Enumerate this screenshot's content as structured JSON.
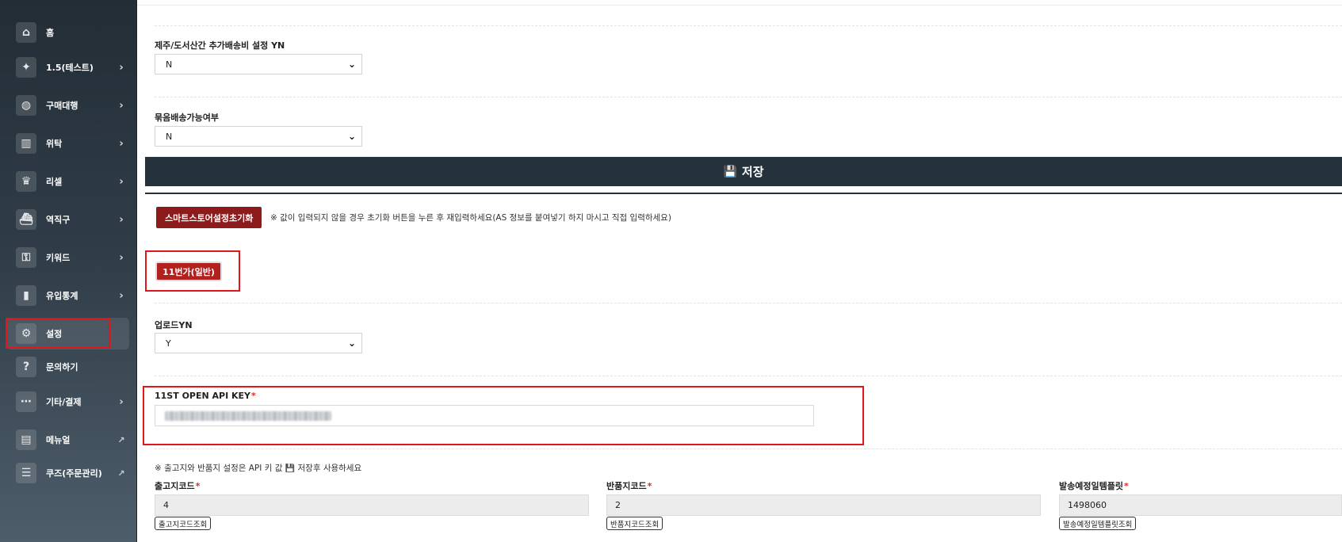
{
  "sidebar": {
    "items": [
      {
        "label": "홈",
        "icon": "home-icon",
        "has_arrow": false
      },
      {
        "label": "1.5(테스트)",
        "icon": "sparkle-icon",
        "has_arrow": true
      },
      {
        "label": "구매대행",
        "icon": "globe-icon",
        "has_arrow": true
      },
      {
        "label": "위탁",
        "icon": "store-icon",
        "has_arrow": true
      },
      {
        "label": "리셀",
        "icon": "crown-icon",
        "has_arrow": true
      },
      {
        "label": "역직구",
        "icon": "ship-icon",
        "has_arrow": true
      },
      {
        "label": "키워드",
        "icon": "key-icon",
        "has_arrow": true
      },
      {
        "label": "유입통계",
        "icon": "bar-chart-icon",
        "has_arrow": true
      },
      {
        "label": "설정",
        "icon": "gear-icon",
        "has_arrow": false,
        "active": true
      },
      {
        "label": "문의하기",
        "icon": "question-icon",
        "has_arrow": false
      },
      {
        "label": "기타/결제",
        "icon": "ellipsis-icon",
        "has_arrow": true
      },
      {
        "label": "메뉴얼",
        "icon": "book-icon",
        "has_arrow": false,
        "external": true
      },
      {
        "label": "쿠즈(주문관리)",
        "icon": "list-check-icon",
        "has_arrow": false,
        "external": true
      }
    ]
  },
  "form": {
    "jeju_label": "제주/도서산간 추가배송비 설정 YN",
    "jeju_value": "N",
    "bundle_label": "묶음배송가능여부",
    "bundle_value": "N"
  },
  "save_label": "저장",
  "reset": {
    "button_label": "스마트스토어설정초기화",
    "note": "※ 값이 입력되지 않을 경우 초기화 버튼을 누른 후 재입력하세요(AS 정보를 붙여넣기 하지 마시고 직접 입력하세요)"
  },
  "market_tab_label": "11번가(일반)",
  "upload": {
    "label": "업로드YN",
    "value": "Y"
  },
  "api_key": {
    "label": "11ST OPEN API KEY",
    "required_mark": "*"
  },
  "note2": {
    "before": "※ 출고지와 반품지 설정은 API 키 값",
    "after": "저장후 사용하세요"
  },
  "fields": {
    "outbound": {
      "label": "출고지코드",
      "value": "4",
      "button": "출고지코드조회"
    },
    "return": {
      "label": "반품지코드",
      "value": "2",
      "button": "반품지코드조회"
    },
    "template": {
      "label": "발송예정일템플릿",
      "value": "1498060",
      "button": "발송예정일템플릿조회"
    }
  },
  "colors": {
    "sidebar_top": "#232d36",
    "save_bar": "#25323b",
    "reset_button": "#8e1b1b",
    "market_button": "#b3211f",
    "highlight": "#e0161c"
  }
}
